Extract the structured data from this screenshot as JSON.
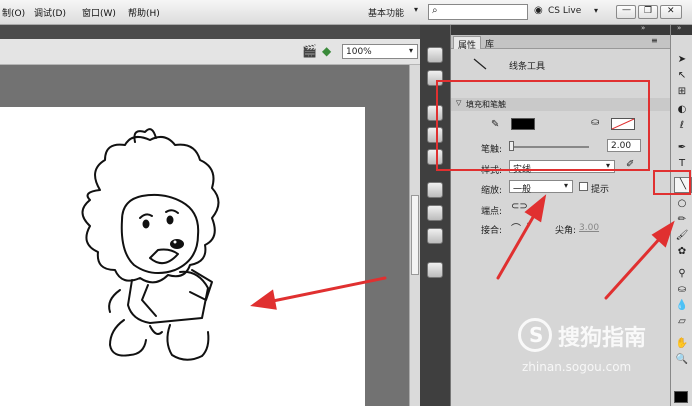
{
  "menu": {
    "items": [
      "制(O)",
      "调试(D)",
      "窗口(W)",
      "帮助(H)"
    ],
    "workspace_label": "基本功能",
    "search_placeholder": "",
    "cs_live_label": "CS Live"
  },
  "stage": {
    "zoom_value": "100%"
  },
  "properties_panel": {
    "tab_properties": "属性",
    "tab_library": "库",
    "tool_name": "线条工具",
    "section_fill_stroke": "填充和笔触",
    "stroke_label": "笔触:",
    "stroke_value": "2.00",
    "style_label": "样式:",
    "style_value": "实线",
    "scale_label": "缩放:",
    "scale_value": "一般",
    "hint_label": "提示",
    "cap_label": "端点:",
    "join_label": "接合:",
    "miter_label": "尖角:",
    "miter_value": "3.00",
    "stroke_color": "#000000"
  },
  "watermark": {
    "brand": "搜狗指南",
    "url": "zhinan.sogou.com"
  },
  "colors": {
    "accent_red": "#e03030"
  }
}
